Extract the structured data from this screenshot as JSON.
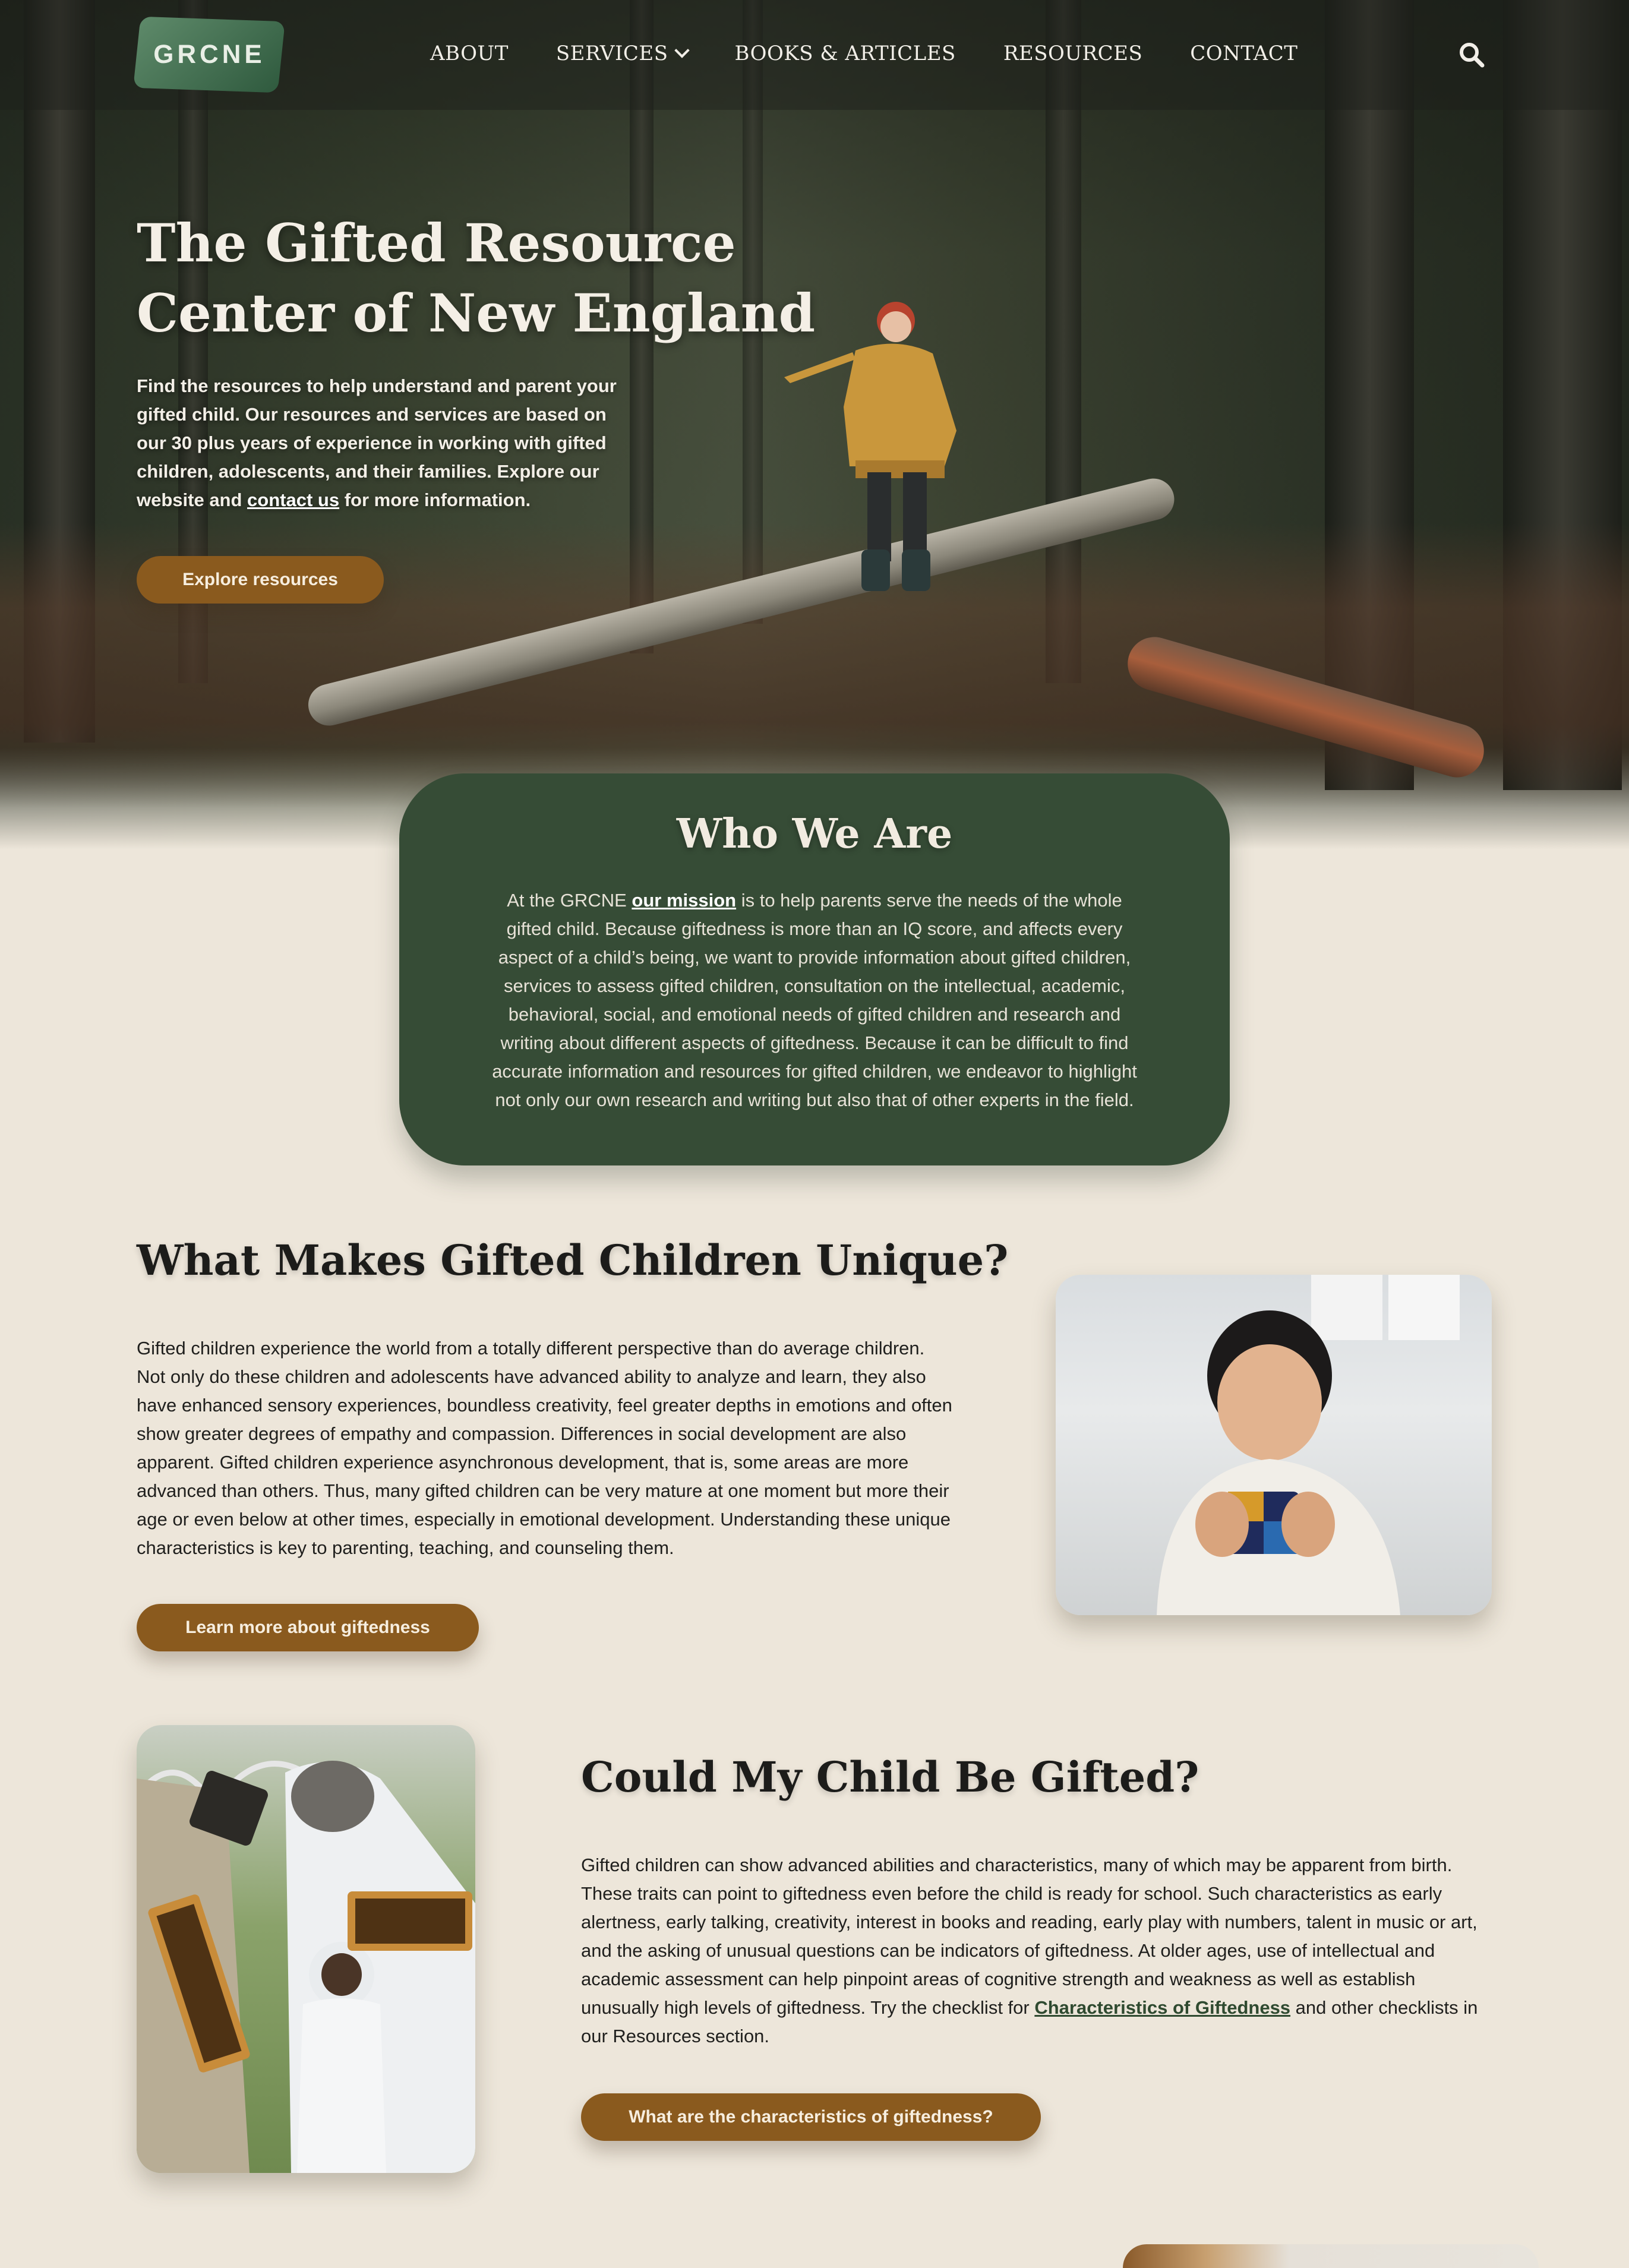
{
  "nav": {
    "logo": "GRCNE",
    "links": [
      "ABOUT",
      "SERVICES",
      "BOOKS & ARTICLES",
      "RESOURCES",
      "CONTACT"
    ],
    "search_icon": "search-icon"
  },
  "hero": {
    "title_line1": "The Gifted Resource",
    "title_line2": "Center of New England",
    "text_before": "Find the resources to help understand and parent your gifted child. Our resources and services are based on our 30 plus years of experience in working with gifted children, adolescents, and their families. Explore our website and ",
    "text_link": "contact us",
    "text_after": " for more information.",
    "button": "Explore resources"
  },
  "who": {
    "title": "Who We Are",
    "text_before": "At the GRCNE ",
    "text_link": "our mission",
    "text_after": " is to help parents serve the needs of the whole gifted child. Because giftedness is more than an IQ score, and affects every aspect of a child’s being, we want to provide information about gifted children, services to assess gifted children, consultation on the intellectual, academic, behavioral, social, and emotional needs of gifted children and research and writing about different aspects of giftedness. Because it can be difficult to find accurate information and resources for gifted children, we endeavor to highlight not only our own research and writing but also that of other experts in the field."
  },
  "unique": {
    "title": "What Makes Gifted Children Unique?",
    "text": "Gifted children experience the world from a totally different perspective than do average children. Not only do these children and adolescents have advanced ability to analyze and learn, they also have enhanced sensory experiences, boundless creativity, feel greater depths in emotions and often show greater degrees of empathy and compassion. Differences in social development are also apparent. Gifted children experience asynchronous development, that is, some areas are more advanced than others. Thus, many gifted children can be very mature at one moment but more their age or even below at other times, especially in emotional development. Understanding these unique characteristics is key to parenting, teaching, and counseling them.",
    "button": "Learn more about giftedness"
  },
  "could": {
    "title": "Could My Child Be Gifted?",
    "text_before": "Gifted children can show advanced abilities and characteristics, many of which may be apparent from birth. These traits can point to giftedness even before the child is ready for school. Such characteristics as early alertness, early talking, creativity, interest in books and reading, early play with numbers, talent in music or art, and the asking of unusual questions can be indicators of giftedness. At older ages, use of intellectual and academic assessment can help pinpoint areas of cognitive strength and weakness as well as establish unusually high levels of giftedness. Try the checklist for ",
    "text_link": "Characteristics of Giftedness",
    "text_after": " and other checklists in our Resources section.",
    "button": "What are the characteristics of giftedness?"
  },
  "colors": {
    "background": "#ede6da",
    "green_card": "#364c36",
    "button": "#8a5a1e"
  }
}
